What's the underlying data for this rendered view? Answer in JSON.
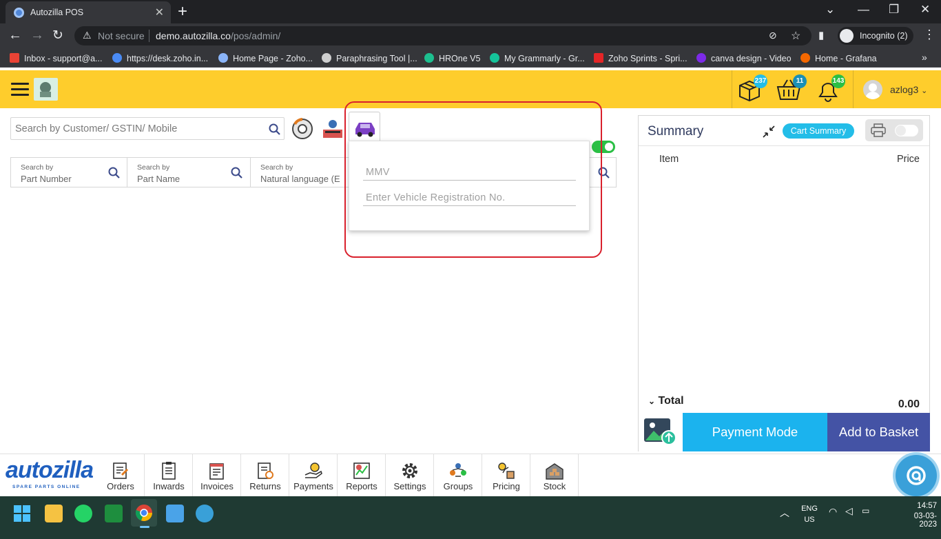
{
  "browser": {
    "tab_title": "Autozilla POS",
    "security_label": "Not secure",
    "url_host": "demo.autozilla.co",
    "url_path": "/pos/admin/",
    "incognito_label": "Incognito (2)"
  },
  "bookmarks": [
    {
      "label": "Inbox - support@a...",
      "icon_color": "#ea4335"
    },
    {
      "label": "https://desk.zoho.in...",
      "icon_color": "#4a8bf5"
    },
    {
      "label": "Home Page - Zoho...",
      "icon_color": "#8ab4f8"
    },
    {
      "label": "Paraphrasing Tool |...",
      "icon_color": "#cfcfcf"
    },
    {
      "label": "HROne V5",
      "icon_color": "#1dbf8f"
    },
    {
      "label": "My Grammarly - Gr...",
      "icon_color": "#15c39a"
    },
    {
      "label": "Zoho Sprints - Spri...",
      "icon_color": "#e42527"
    },
    {
      "label": "canva design - Video",
      "icon_color": "#7d2ae8"
    },
    {
      "label": "Home - Grafana",
      "icon_color": "#f46800"
    }
  ],
  "header": {
    "parcel_badge": "237",
    "basket_badge": "11",
    "bell_badge": "143",
    "username": "azlog3"
  },
  "search": {
    "customer_placeholder": "Search by Customer/ GSTIN/ Mobile",
    "fields": [
      {
        "label": "Search by",
        "value": "Part Number"
      },
      {
        "label": "Search by",
        "value": "Part Name"
      },
      {
        "label": "Search by",
        "value": "Natural language (E"
      }
    ]
  },
  "vehicle_popup": {
    "mmv_placeholder": "MMV",
    "reg_placeholder": "Enter Vehicle Registration No."
  },
  "summary": {
    "title": "Summary",
    "cart_summary_label": "Cart Summary",
    "col_item": "Item",
    "col_price": "Price",
    "total_label": "Total",
    "total_value": "0.00",
    "payment_mode_label": "Payment Mode",
    "add_to_basket_label": "Add to Basket"
  },
  "bottom_nav": {
    "logo_text": "autozilla",
    "logo_tagline": "SPARE PARTS ONLINE",
    "items": [
      "Orders",
      "Inwards",
      "Invoices",
      "Returns",
      "Payments",
      "Reports",
      "Settings",
      "Groups",
      "Pricing",
      "Stock"
    ]
  },
  "taskbar": {
    "lang_line1": "ENG",
    "lang_line2": "US",
    "time": "14:57",
    "date": "03-03-2023"
  },
  "colors": {
    "header_yellow": "#fecd2c",
    "accent_blue": "#1bb3ee",
    "basket_navy": "#4453a5",
    "highlight_red": "#d9202c",
    "toggle_green": "#2bbf45"
  }
}
